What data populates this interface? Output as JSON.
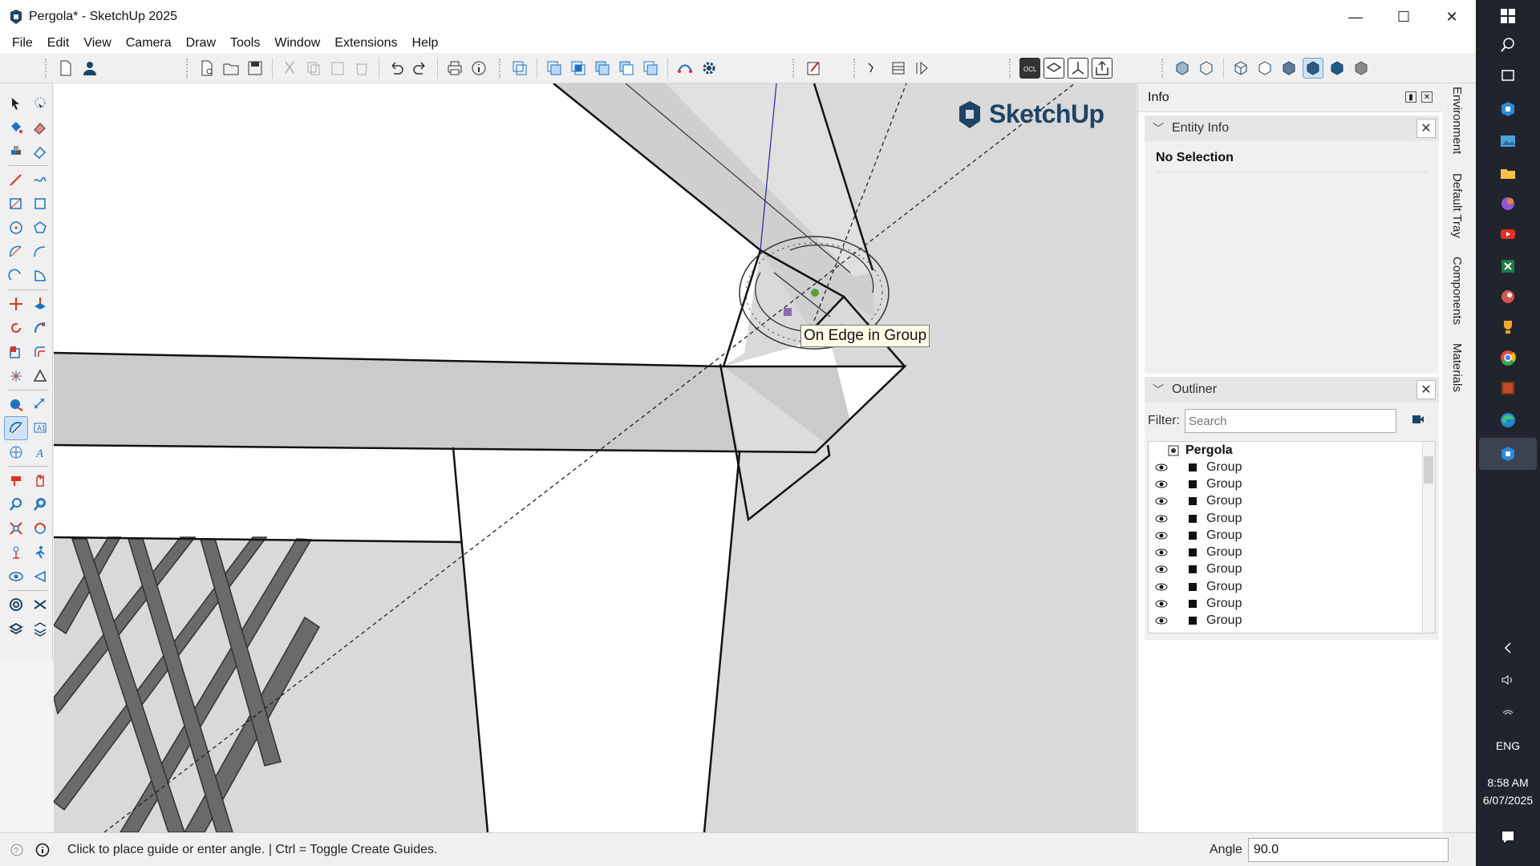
{
  "window": {
    "title": "Pergola* - SketchUp 2025",
    "minimize": "—",
    "maximize": "☐",
    "close": "✕"
  },
  "menu": [
    "File",
    "Edit",
    "View",
    "Camera",
    "Draw",
    "Tools",
    "Window",
    "Extensions",
    "Help"
  ],
  "viewport": {
    "logo_text": "SketchUp",
    "tooltip": "On Edge in Group"
  },
  "tray": {
    "title": "Info",
    "entity_info": {
      "title": "Entity Info",
      "selection": "No Selection"
    },
    "outliner": {
      "title": "Outliner",
      "filter_label": "Filter:",
      "filter_placeholder": "Search",
      "root": "Pergola",
      "items": [
        "Group",
        "Group",
        "Group",
        "Group",
        "Group",
        "Group",
        "Group",
        "Group",
        "Group",
        "Group"
      ]
    },
    "vertical_tabs": [
      "Environment",
      "Default Tray",
      "Components",
      "Materials"
    ]
  },
  "status": {
    "message": "Click to place guide or enter angle. | Ctrl = Toggle Create Guides.",
    "vcb_label": "Angle",
    "vcb_value": "90.0"
  },
  "taskbar": {
    "language": "ENG",
    "time": "8:58 AM",
    "date": "6/07/2025"
  },
  "colors": {
    "accent": "#1c4466",
    "active_tool": "#cfe2f5",
    "viewport_bg": "#d9d9d9"
  }
}
